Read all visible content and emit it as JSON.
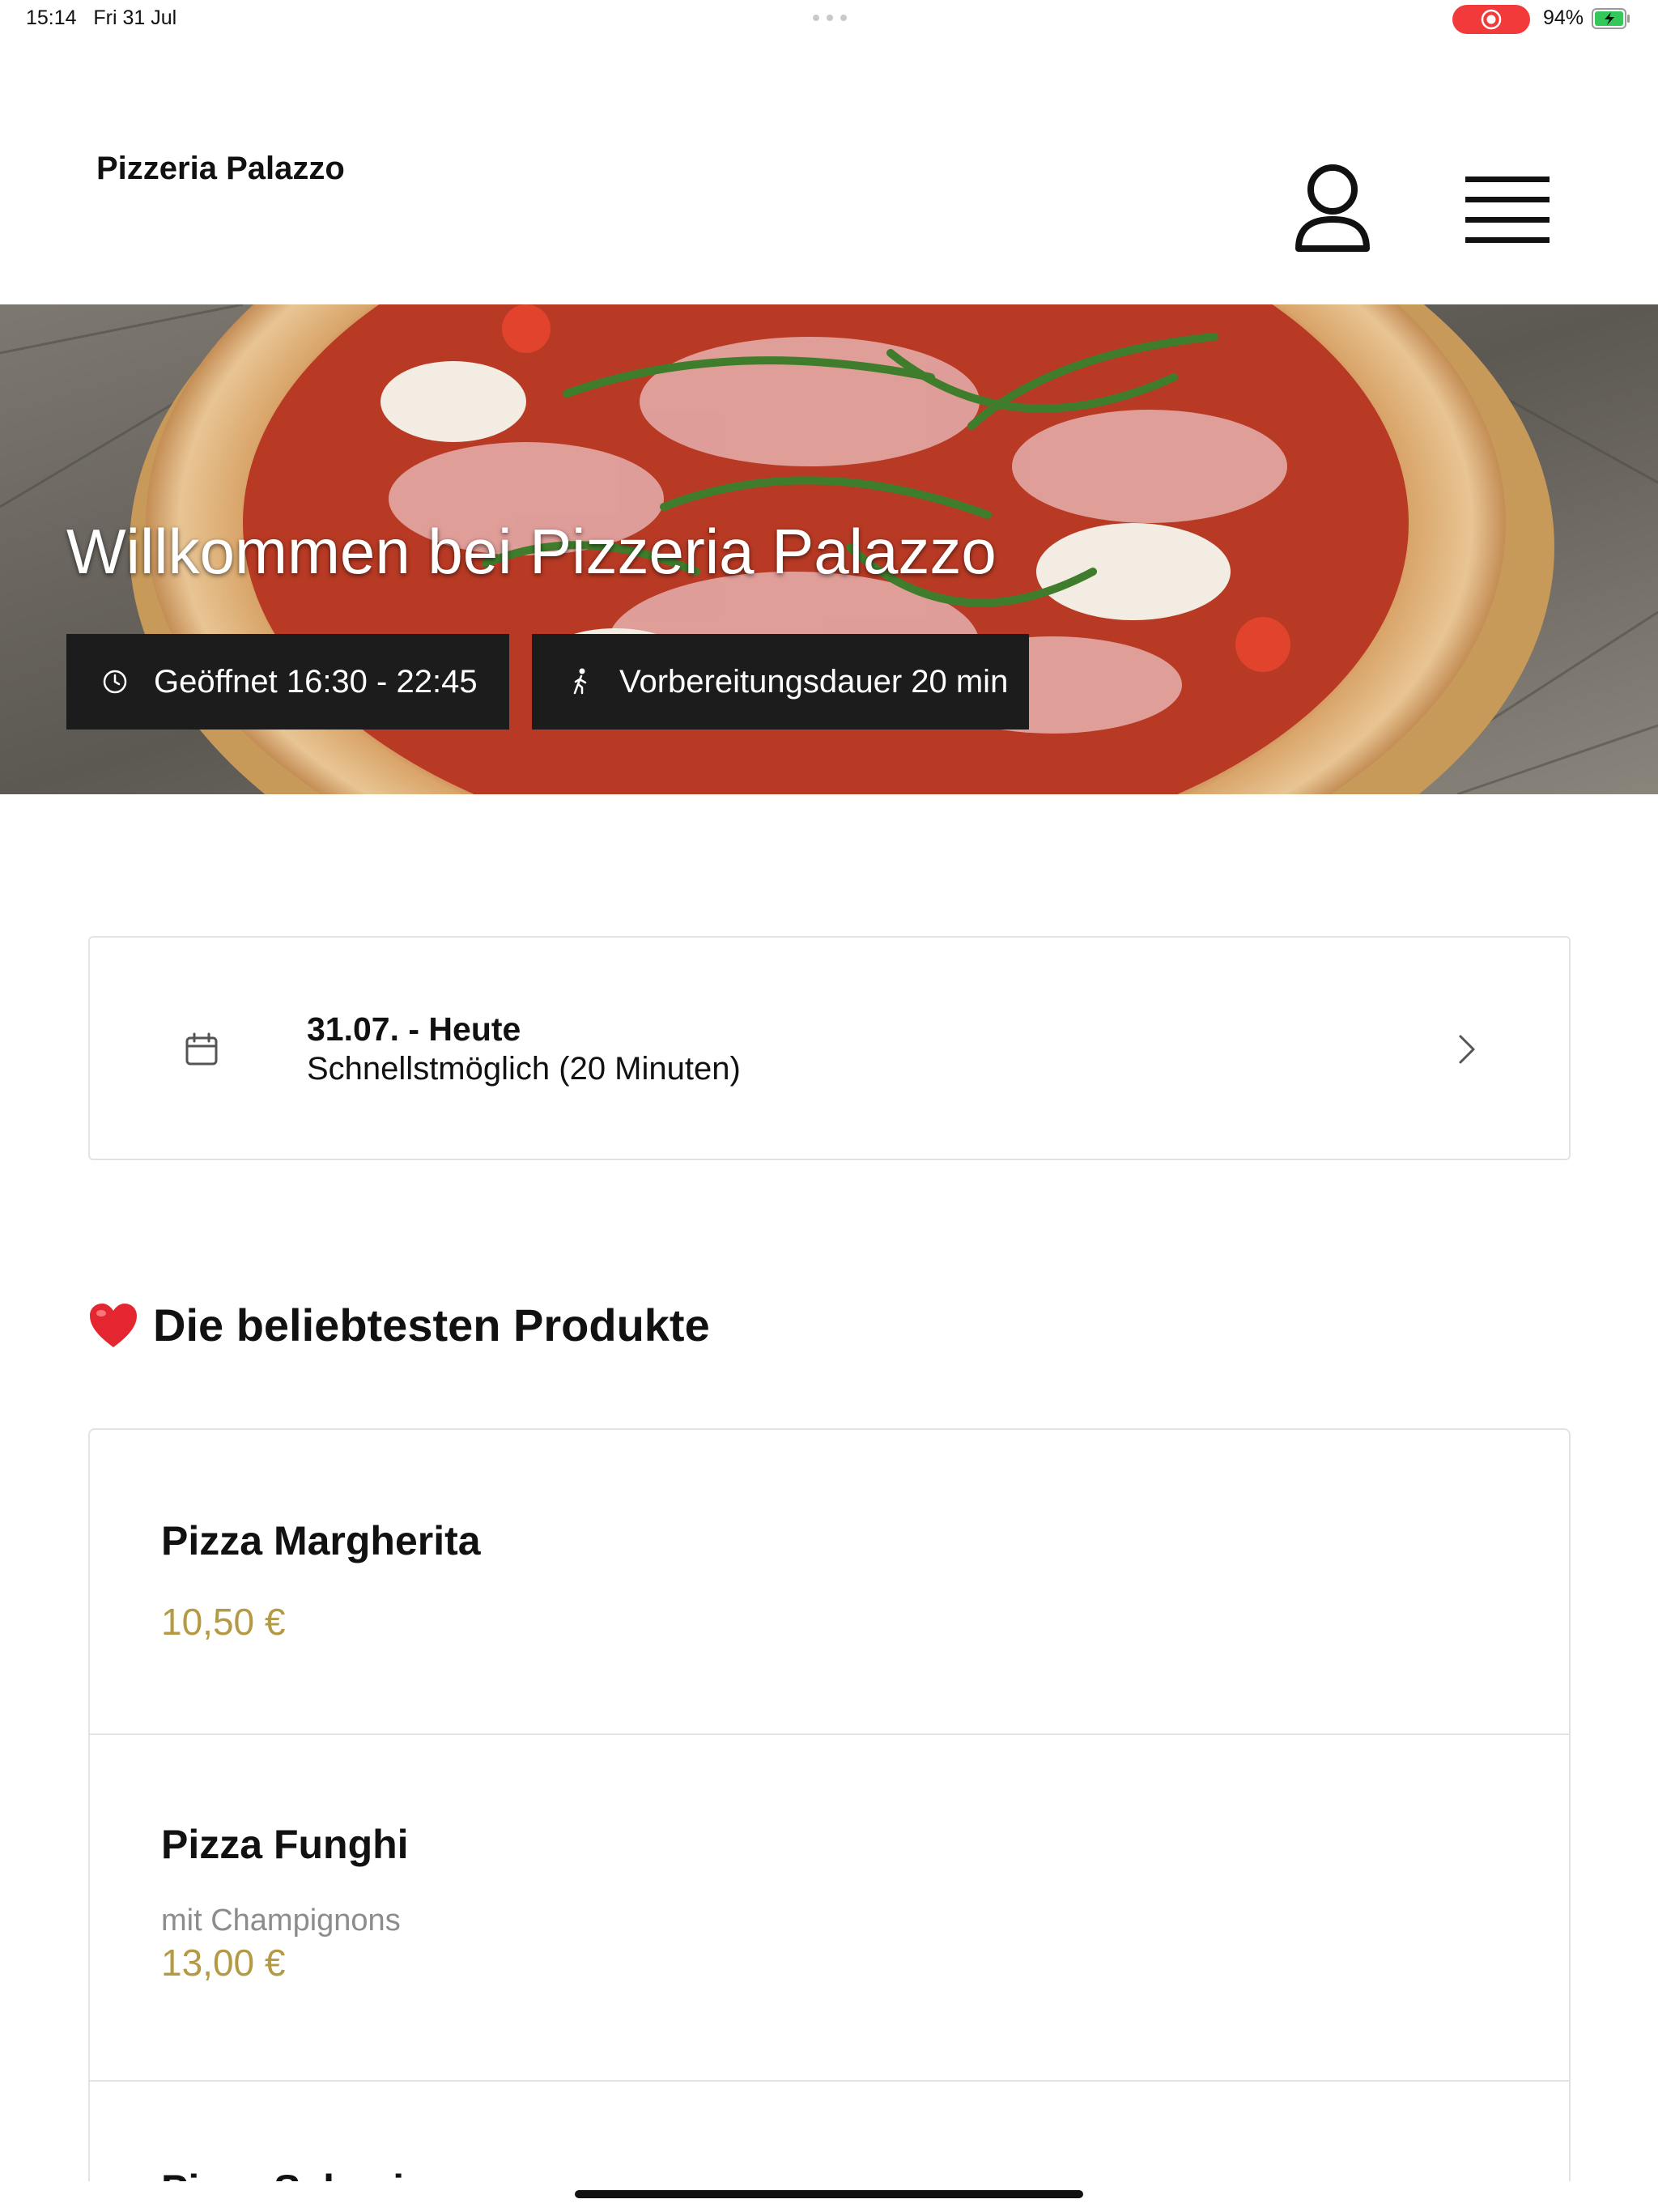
{
  "status_bar": {
    "time": "15:14",
    "date": "Fri 31 Jul",
    "battery": "94%"
  },
  "header": {
    "brand": "Pizzeria Palazzo"
  },
  "hero": {
    "title": "Willkommen bei Pizzeria Palazzo",
    "open_label": "Geöffnet 16:30 - 22:45",
    "prep_label": "Vorbereitungsdauer 20 min"
  },
  "date_picker": {
    "title": "31.07. - Heute",
    "subtitle": "Schnellstmöglich (20 Minuten)"
  },
  "popular": {
    "heading": "Die beliebtesten Produkte",
    "products": [
      {
        "name": "Pizza Margherita",
        "description": "",
        "price": "10,50 €"
      },
      {
        "name": "Pizza Funghi",
        "description": "mit Champignons",
        "price": "13,00 €"
      },
      {
        "name": "Pizza Salami",
        "description": "",
        "price": ""
      }
    ]
  },
  "colors": {
    "price": "#b49a44",
    "recording": "#f23a3a",
    "chip_bg": "#1c1c1c",
    "heart": "#e3262f",
    "battery": "#34c759"
  }
}
